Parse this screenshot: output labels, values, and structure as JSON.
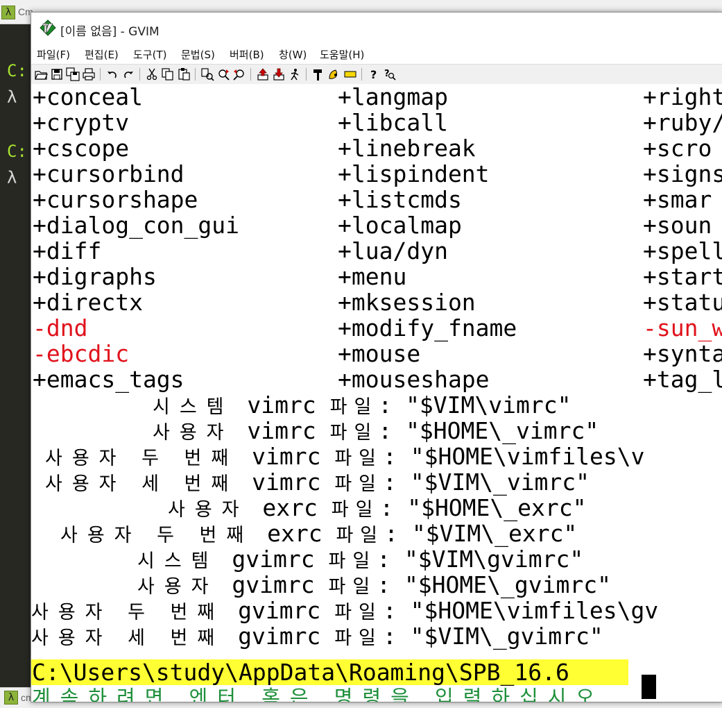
{
  "background_terminal": {
    "tab_label_top": "Cm",
    "tab_label_bottom": "cmd.exe",
    "lambda": "λ",
    "prompt_lines": [
      {
        "c": "C:",
        "l": "λ"
      },
      {
        "c": "C:",
        "l": "λ"
      }
    ],
    "colors": {
      "prompt": "#a6e22e",
      "badge": "#8cb33a"
    }
  },
  "window": {
    "title": "[이름 없음] - GVIM",
    "icon": "vim-logo-icon"
  },
  "menu": [
    {
      "label": "파일(F)"
    },
    {
      "label": "편집(E)"
    },
    {
      "label": "도구(T)"
    },
    {
      "label": "문법(S)"
    },
    {
      "label": "버퍼(B)"
    },
    {
      "label": "창(W)"
    },
    {
      "label": "도움말(H)"
    }
  ],
  "toolbar": {
    "buttons": [
      "open-icon",
      "save-icon",
      "save-all-icon",
      "print-icon",
      "undo-icon",
      "redo-icon",
      "cut-icon",
      "copy-icon",
      "paste-icon",
      "find-replace-icon",
      "find-next-icon",
      "find-prev-icon",
      "load-session-icon",
      "save-session-icon",
      "run-script-icon",
      "make-icon",
      "shell-icon",
      "ctags-icon",
      "help-icon",
      "find-help-icon"
    ]
  },
  "features": {
    "col1": [
      {
        "text": "+conceal",
        "enabled": true
      },
      {
        "text": "+cryptv",
        "enabled": true
      },
      {
        "text": "+cscope",
        "enabled": true
      },
      {
        "text": "+cursorbind",
        "enabled": true
      },
      {
        "text": "+cursorshape",
        "enabled": true
      },
      {
        "text": "+dialog_con_gui",
        "enabled": true
      },
      {
        "text": "+diff",
        "enabled": true
      },
      {
        "text": "+digraphs",
        "enabled": true
      },
      {
        "text": "+directx",
        "enabled": true
      },
      {
        "text": "-dnd",
        "enabled": false
      },
      {
        "text": "-ebcdic",
        "enabled": false
      },
      {
        "text": "+emacs_tags",
        "enabled": true
      }
    ],
    "col2": [
      {
        "text": "+langmap",
        "enabled": true
      },
      {
        "text": "+libcall",
        "enabled": true
      },
      {
        "text": "+linebreak",
        "enabled": true
      },
      {
        "text": "+lispindent",
        "enabled": true
      },
      {
        "text": "+listcmds",
        "enabled": true
      },
      {
        "text": "+localmap",
        "enabled": true
      },
      {
        "text": "+lua/dyn",
        "enabled": true
      },
      {
        "text": "+menu",
        "enabled": true
      },
      {
        "text": "+mksession",
        "enabled": true
      },
      {
        "text": "+modify_fname",
        "enabled": true
      },
      {
        "text": "+mouse",
        "enabled": true
      },
      {
        "text": "+mouseshape",
        "enabled": true
      }
    ],
    "col3": [
      {
        "text": "+right",
        "enabled": true
      },
      {
        "text": "+ruby/",
        "enabled": true
      },
      {
        "text": "+scro",
        "enabled": true
      },
      {
        "text": "+signs",
        "enabled": true
      },
      {
        "text": "+smar",
        "enabled": true
      },
      {
        "text": "+soun",
        "enabled": true
      },
      {
        "text": "+spell",
        "enabled": true
      },
      {
        "text": "+start",
        "enabled": true
      },
      {
        "text": "+statu",
        "enabled": true
      },
      {
        "text": "-sun_w",
        "enabled": false
      },
      {
        "text": "+synta",
        "enabled": true
      },
      {
        "text": "+tag_l",
        "enabled": true
      }
    ]
  },
  "config_files": [
    {
      "label": "시스템",
      "kind": "vimrc",
      "path": "\"$VIM\\vimrc\""
    },
    {
      "label": "사용자",
      "kind": "vimrc",
      "path": "\"$HOME\\_vimrc\""
    },
    {
      "label": "사용자 두 번째",
      "kind": "vimrc",
      "path": "\"$HOME\\vimfiles\\v"
    },
    {
      "label": "사용자 세 번째",
      "kind": "vimrc",
      "path": "\"$VIM\\_vimrc\""
    },
    {
      "label": "사용자",
      "kind": "exrc",
      "path": "\"$HOME\\_exrc\""
    },
    {
      "label": "사용자 두 번째",
      "kind": "exrc",
      "path": "\"$VIM\\_exrc\""
    },
    {
      "label": "시스템",
      "kind": "gvimrc",
      "path": "\"$VIM\\gvimrc\""
    },
    {
      "label": "사용자",
      "kind": "gvimrc",
      "path": "\"$HOME\\_gvimrc\""
    },
    {
      "label": "사용자 두 번째",
      "kind": "gvimrc",
      "path": "\"$HOME\\vimfiles\\gv"
    },
    {
      "label": "사용자 세 번째",
      "kind": "gvimrc",
      "path": "\"$VIM\\_gvimrc\""
    }
  ],
  "file_word": "파일",
  "colon": ":",
  "path_line": "C:\\Users\\study\\AppData\\Roaming\\SPB_16.6",
  "more_prompt": "계속하려면 엔터 혹은 명령을 입력하십시오",
  "colors": {
    "disabled_feature": "#e0121c",
    "highlight": "#ffff33",
    "more_prompt": "#1e8f3a"
  }
}
